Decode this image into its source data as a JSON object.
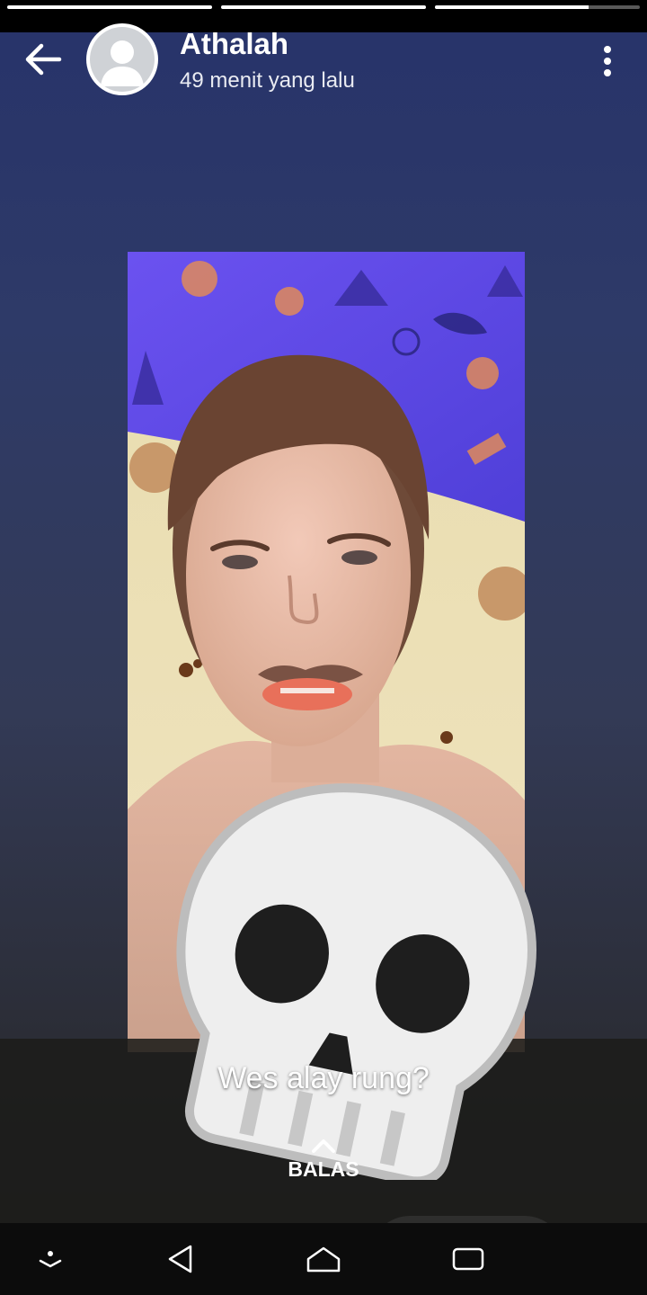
{
  "story": {
    "user_name": "Athalah",
    "time_ago": "49 menit yang lalu",
    "caption": "Wes alay rung?",
    "reply_label": "BALAS",
    "segments": [
      {
        "progress": 1.0
      },
      {
        "progress": 1.0
      },
      {
        "progress": 0.75
      }
    ]
  },
  "icons": {
    "back": "arrow-left-icon",
    "menu": "more-vert-icon",
    "avatar": "default-avatar-icon",
    "reply": "chevron-up-icon",
    "sticker": "skull-emoji",
    "nav_hide": "hide-keyboard-icon",
    "nav_back": "triangle-back-icon",
    "nav_home": "home-icon",
    "nav_recents": "recents-icon"
  },
  "colors": {
    "background_top": "#27336a",
    "background_bottom": "#1c1c1e",
    "text": "#ffffff"
  }
}
